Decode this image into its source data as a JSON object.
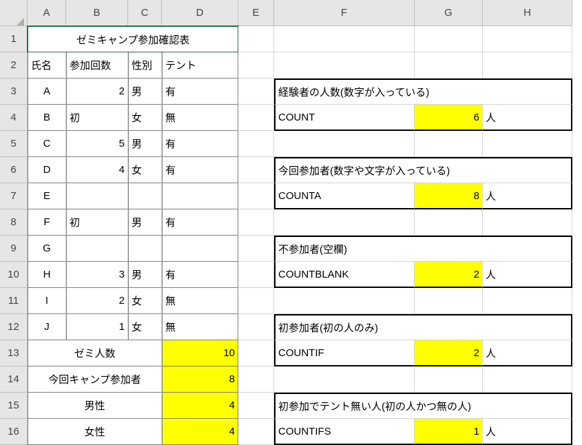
{
  "columns": [
    "A",
    "B",
    "C",
    "D",
    "E",
    "F",
    "G",
    "H"
  ],
  "rows": [
    "1",
    "2",
    "3",
    "4",
    "5",
    "6",
    "7",
    "8",
    "9",
    "10",
    "11",
    "12",
    "13",
    "14",
    "15",
    "16"
  ],
  "title": "ゼミキャンプ参加確認表",
  "headers": {
    "name": "氏名",
    "count": "参加回数",
    "sex": "性別",
    "tent": "テント"
  },
  "data": [
    {
      "name": "A",
      "count": "2",
      "sex": "男",
      "tent": "有"
    },
    {
      "name": "B",
      "count": "初",
      "sex": "女",
      "tent": "無"
    },
    {
      "name": "C",
      "count": "5",
      "sex": "男",
      "tent": "有"
    },
    {
      "name": "D",
      "count": "4",
      "sex": "女",
      "tent": "有"
    },
    {
      "name": "E",
      "count": "",
      "sex": "",
      "tent": ""
    },
    {
      "name": "F",
      "count": "初",
      "sex": "男",
      "tent": "有"
    },
    {
      "name": "G",
      "count": "",
      "sex": "",
      "tent": ""
    },
    {
      "name": "H",
      "count": "3",
      "sex": "男",
      "tent": "有"
    },
    {
      "name": "I",
      "count": "2",
      "sex": "女",
      "tent": "無"
    },
    {
      "name": "J",
      "count": "1",
      "sex": "女",
      "tent": "無"
    }
  ],
  "summary": {
    "total_label": "ゼミ人数",
    "total_val": "10",
    "camp_label": "今回キャンプ参加者",
    "camp_val": "8",
    "male_label": "男性",
    "male_val": "4",
    "female_label": "女性",
    "female_val": "4"
  },
  "cards": {
    "c1": {
      "title": "経験者の人数(数字が入っている)",
      "func": "COUNT",
      "val": "6",
      "unit": "人"
    },
    "c2": {
      "title": "今回参加者(数字や文字が入っている)",
      "func": "COUNTA",
      "val": "8",
      "unit": "人"
    },
    "c3": {
      "title": "不参加者(空欄)",
      "func": "COUNTBLANK",
      "val": "2",
      "unit": "人"
    },
    "c4": {
      "title": "初参加者(初の人のみ)",
      "func": "COUNTIF",
      "val": "2",
      "unit": "人"
    },
    "c5": {
      "title": "初参加でテント無い人(初の人かつ無の人)",
      "func": "COUNTIFS",
      "val": "1",
      "unit": "人"
    }
  }
}
